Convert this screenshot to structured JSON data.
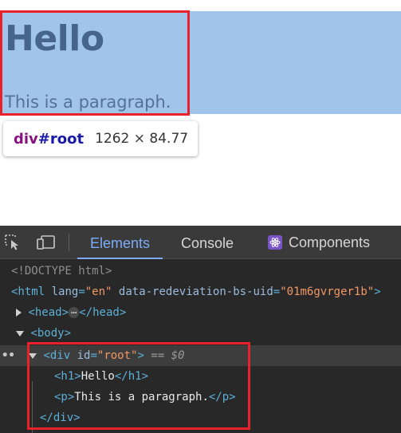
{
  "page": {
    "heading": "Hello",
    "paragraph": "This is a paragraph."
  },
  "tooltip": {
    "tag": "div",
    "id": "#root",
    "dimensions": "1262 × 84.77"
  },
  "devtools": {
    "tabs": [
      {
        "label": "Elements",
        "active": true
      },
      {
        "label": "Console",
        "active": false
      },
      {
        "label": "Components",
        "active": false
      }
    ],
    "dom": {
      "doctype": "<!DOCTYPE html>",
      "html_open": "<html",
      "html_attr1_name": "lang",
      "html_attr1_val": "\"en\"",
      "html_attr2_name": "data-redeviation-bs-uid",
      "html_attr2_val": "\"01m6gvrger1b\"",
      "html_close_bracket": ">",
      "head_open": "<head>",
      "head_ellipsis": "⋯",
      "head_close": "</head>",
      "body_open": "<body>",
      "div_open": "<div",
      "div_attr_name": "id",
      "div_attr_val": "\"root\"",
      "div_open_close": ">",
      "selected_marker": "== $0",
      "h1_open": "<h1>",
      "h1_text": "Hello",
      "h1_close": "</h1>",
      "p_open": "<p>",
      "p_text": "This is a paragraph.",
      "p_close": "</p>",
      "div_close": "</div>",
      "gutter": "••"
    }
  },
  "colors": {
    "highlight": "#a0c4ea",
    "annotation_red": "#e8212b",
    "active_tab": "#7cacf8",
    "tag": "#5db0d7",
    "attr_value": "#f29766"
  }
}
